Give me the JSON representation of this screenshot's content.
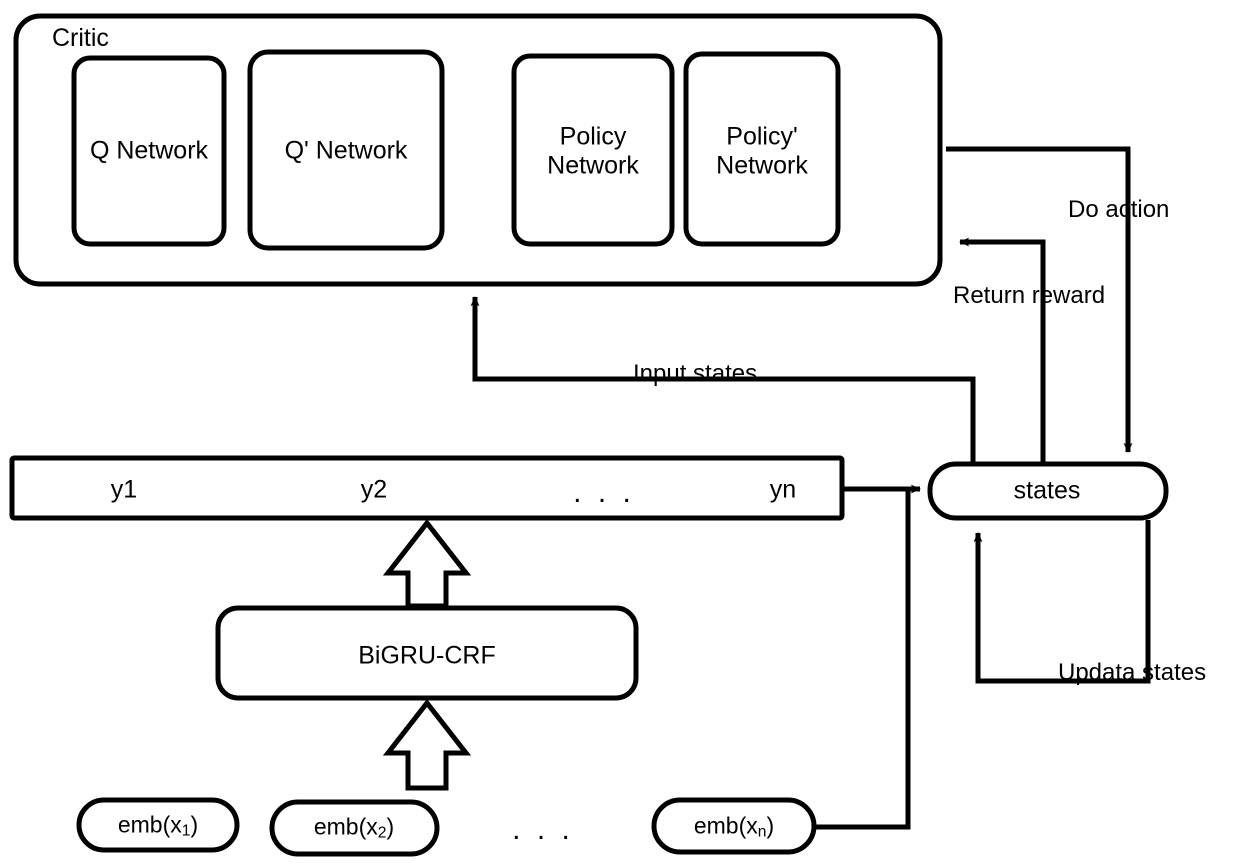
{
  "diagram": {
    "title_text": "Critic",
    "critic_group": {
      "label": "Critic",
      "networks": [
        {
          "name": "q-network",
          "label": "Q Network"
        },
        {
          "name": "q-prime-network",
          "label": "Q'  Network"
        },
        {
          "name": "policy-network",
          "label": "Policy\nNetwork",
          "line1": "Policy",
          "line2": "Network"
        },
        {
          "name": "policy-prime-network",
          "label": "Policy'\nNetwork",
          "line1": "Policy'",
          "line2": "Network"
        }
      ]
    },
    "states_node": {
      "label": "states"
    },
    "sequence_bar": {
      "tokens": [
        "y1",
        "y2",
        ". . .",
        "yn"
      ]
    },
    "encoder_box": {
      "label": "BiGRU-CRF"
    },
    "embeddings": {
      "ellipsis": ". . .",
      "items": [
        {
          "prefix": "emb(x",
          "sub": "1",
          "suffix": ")"
        },
        {
          "prefix": "emb(x",
          "sub": "2",
          "suffix": ")"
        },
        {
          "prefix": "emb(x",
          "sub": "n",
          "suffix": ")"
        }
      ]
    },
    "edge_labels": {
      "do_action": "Do action",
      "return_reward": "Return reward",
      "input_states": "Input states",
      "update_states": "Updata states"
    },
    "colors": {
      "stroke": "#000000",
      "background": "#ffffff",
      "text": "#000000"
    }
  }
}
